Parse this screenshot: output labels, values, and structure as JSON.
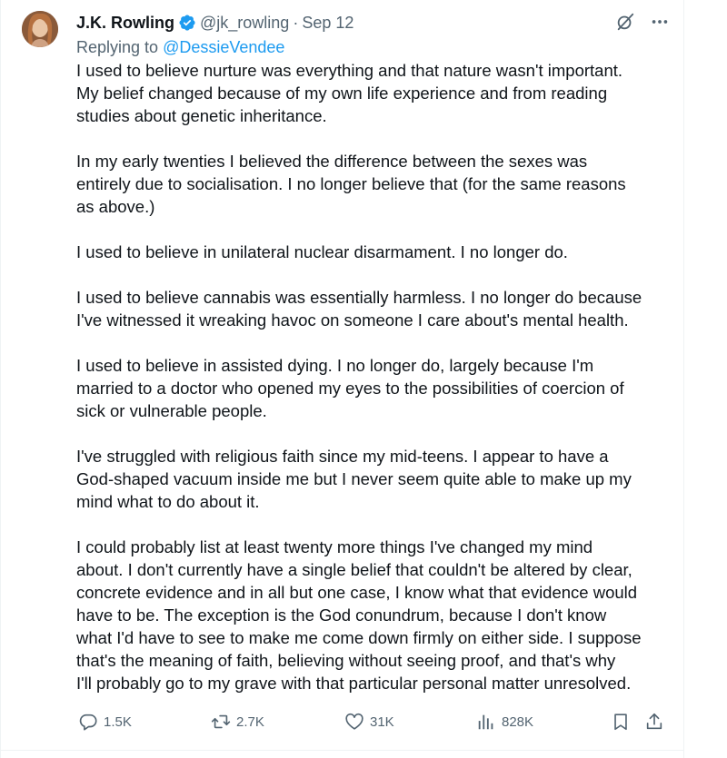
{
  "tweet": {
    "author_name": "J.K. Rowling",
    "handle": "@jk_rowling",
    "separator": "·",
    "date": "Sep 12",
    "replying_prefix": "Replying to ",
    "replying_to": "@DessieVendee",
    "paragraphs": [
      "I used to believe nurture was everything and that nature wasn't important.\nMy belief changed because of my own life experience and from reading\nstudies about genetic inheritance.",
      "In my early twenties I believed the difference between the sexes was\nentirely due to socialisation. I no longer believe that (for the same reasons\nas above.)",
      "I used to believe in unilateral nuclear disarmament. I no longer do.",
      "I used to believe cannabis was essentially harmless. I no longer do because\nI've witnessed it wreaking havoc on someone I care about's mental health.",
      "I used to believe in assisted dying. I no longer do, largely because I'm\nmarried to a doctor who opened my eyes to the possibilities of coercion of\nsick or vulnerable people.",
      "I've struggled with religious faith since my mid-teens. I appear to have a\nGod-shaped vacuum inside me but I never seem quite able to make up my\nmind what to do about it.",
      "I could probably list at least twenty more things I've changed my mind\nabout. I don't currently have a single belief that couldn't be altered by clear,\nconcrete evidence and in all but one case, I know what that evidence would\nhave to be. The exception is the God conundrum, because I don't know\nwhat I'd have to see to make me come down firmly on either side. I suppose\nthat's the meaning of faith, believing without seeing proof, and that's why\nI'll probably go to my grave with that particular personal matter unresolved."
    ]
  },
  "stats": {
    "replies": "1.5K",
    "reposts": "2.7K",
    "likes": "31K",
    "views": "828K"
  },
  "icons": {
    "verified": "verified-badge-icon",
    "grok": "grok-icon",
    "more": "more-icon",
    "reply": "reply-icon",
    "repost": "repost-icon",
    "like": "like-icon",
    "views": "views-icon",
    "bookmark": "bookmark-icon",
    "share": "share-icon"
  },
  "colors": {
    "accent": "#1d9bf0",
    "text": "#0f1419",
    "secondary": "#536471",
    "border": "#eff3f4"
  }
}
